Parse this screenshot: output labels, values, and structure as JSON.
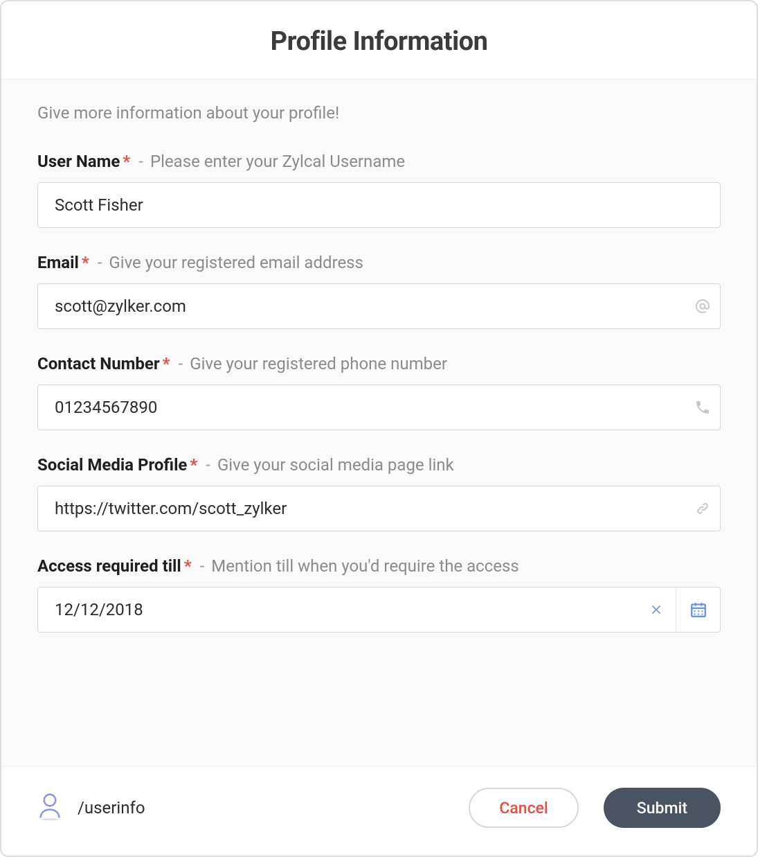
{
  "header": {
    "title": "Profile Information"
  },
  "intro": "Give more information about your profile!",
  "fields": {
    "username": {
      "label": "User Name",
      "required_mark": "*",
      "separator": "-",
      "hint": "Please enter your Zylcal Username",
      "value": "Scott Fisher"
    },
    "email": {
      "label": "Email",
      "required_mark": "*",
      "separator": "-",
      "hint": "Give your registered email address",
      "value": "scott@zylker.com"
    },
    "contact": {
      "label": "Contact Number",
      "required_mark": "*",
      "separator": "-",
      "hint": "Give your registered phone number",
      "value": "01234567890"
    },
    "social": {
      "label": "Social Media Profile",
      "required_mark": "*",
      "separator": "-",
      "hint": "Give your social media page link",
      "value": "https://twitter.com/scott_zylker"
    },
    "access": {
      "label": "Access required till",
      "required_mark": "*",
      "separator": "-",
      "hint": "Mention till when you'd require the access",
      "value": "12/12/2018"
    }
  },
  "footer": {
    "path": "/userinfo",
    "cancel_label": "Cancel",
    "submit_label": "Submit"
  },
  "colors": {
    "accent_submit": "#4a5362",
    "accent_cancel_text": "#e74c3c",
    "accent_icon_blue": "#5b8def",
    "accent_user_icon": "#8a8fe8"
  }
}
